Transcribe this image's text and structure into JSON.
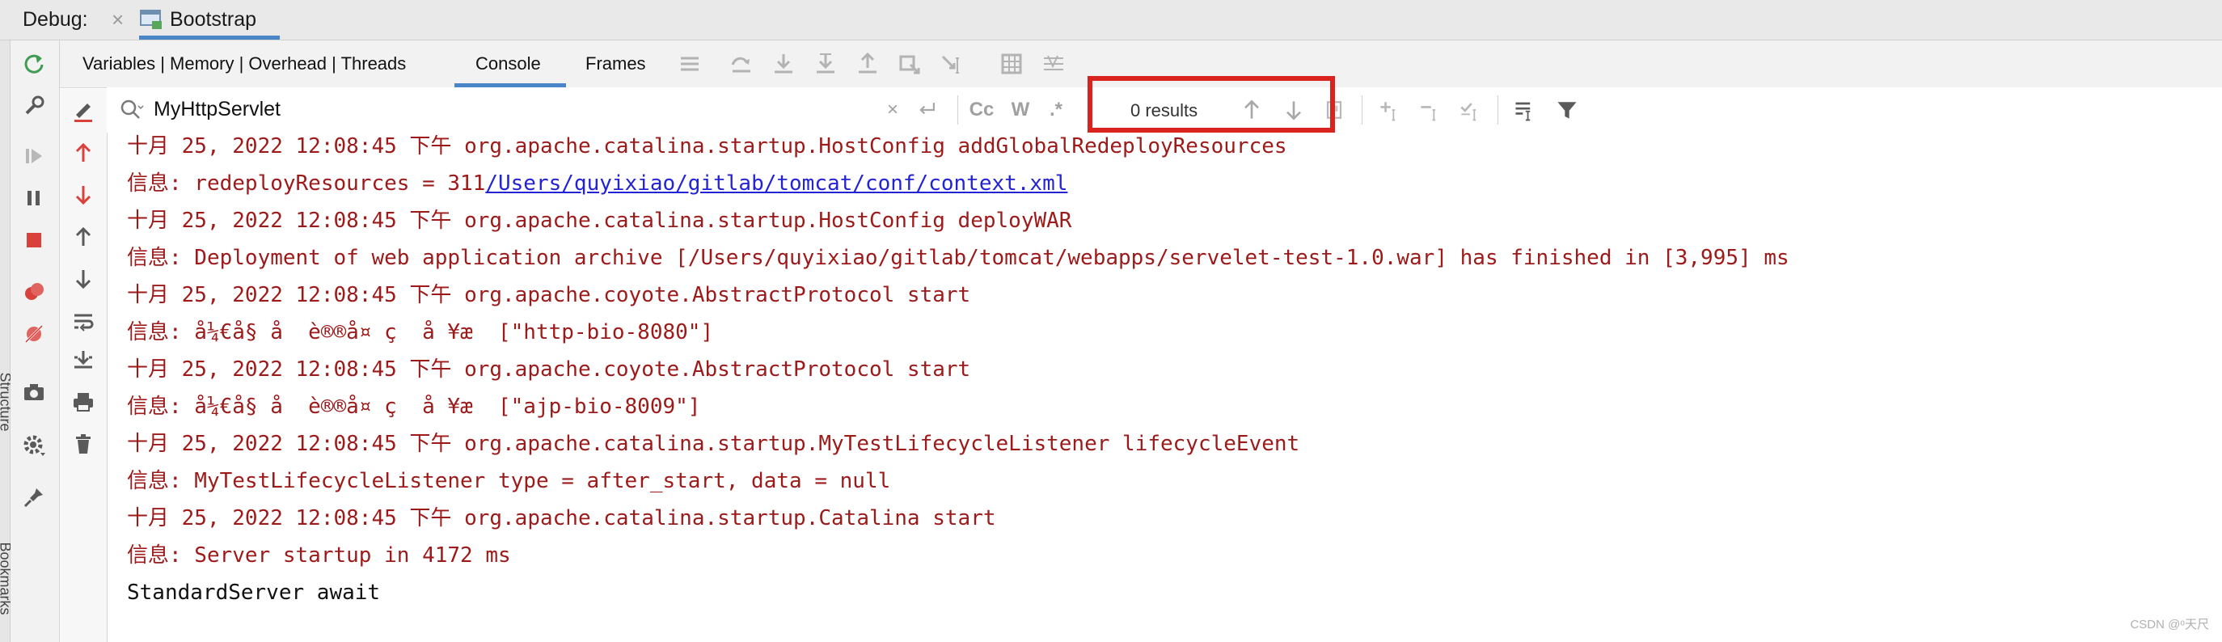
{
  "titlebar": {
    "debug_label": "Debug:",
    "close_glyph": "×",
    "tab_title": "Bootstrap"
  },
  "side_labels": {
    "top": "Structure",
    "bottom": "Bookmarks"
  },
  "subtoolbar": {
    "vars_text": "Variables | Memory | Overhead | Threads",
    "tabs": [
      "Console",
      "Frames"
    ],
    "active_tab": "Console"
  },
  "search": {
    "value": "MyHttpServlet",
    "clear_glyph": "×",
    "match_case": "Cc",
    "words": "W",
    "regex": ".*",
    "results": "0 results"
  },
  "console": {
    "lines": [
      "十月 25, 2022 12:08:45 下午 org.apache.catalina.startup.HostConfig addGlobalRedeployResources",
      "信息: redeployResources = 311",
      "十月 25, 2022 12:08:45 下午 org.apache.catalina.startup.HostConfig deployWAR",
      "信息: Deployment of web application archive [/Users/quyixiao/gitlab/tomcat/webapps/servelet-test-1.0.war] has finished in [3,995] ms",
      "十月 25, 2022 12:08:45 下午 org.apache.coyote.AbstractProtocol start",
      "信息: å¼€å§ å  è®®å¤ ç  å ¥æ  [\"http-bio-8080\"]",
      "十月 25, 2022 12:08:45 下午 org.apache.coyote.AbstractProtocol start",
      "信息: å¼€å§ å  è®®å¤ ç  å ¥æ  [\"ajp-bio-8009\"]",
      "十月 25, 2022 12:08:45 下午 org.apache.catalina.startup.MyTestLifecycleListener lifecycleEvent",
      "信息: MyTestLifecycleListener type = after_start, data = null",
      "十月 25, 2022 12:08:45 下午 org.apache.catalina.startup.Catalina start",
      "信息: Server startup in 4172 ms",
      "StandardServer await"
    ],
    "link_text": "/Users/quyixiao/gitlab/tomcat/conf/context.xml"
  },
  "colors": {
    "error_text": "#9d1a1a",
    "plain_text": "#111111",
    "link": "#2323d6",
    "accent": "#4a86c7",
    "highlight_box": "#d8231e"
  },
  "watermark": "CSDN @ᵒ天尺"
}
